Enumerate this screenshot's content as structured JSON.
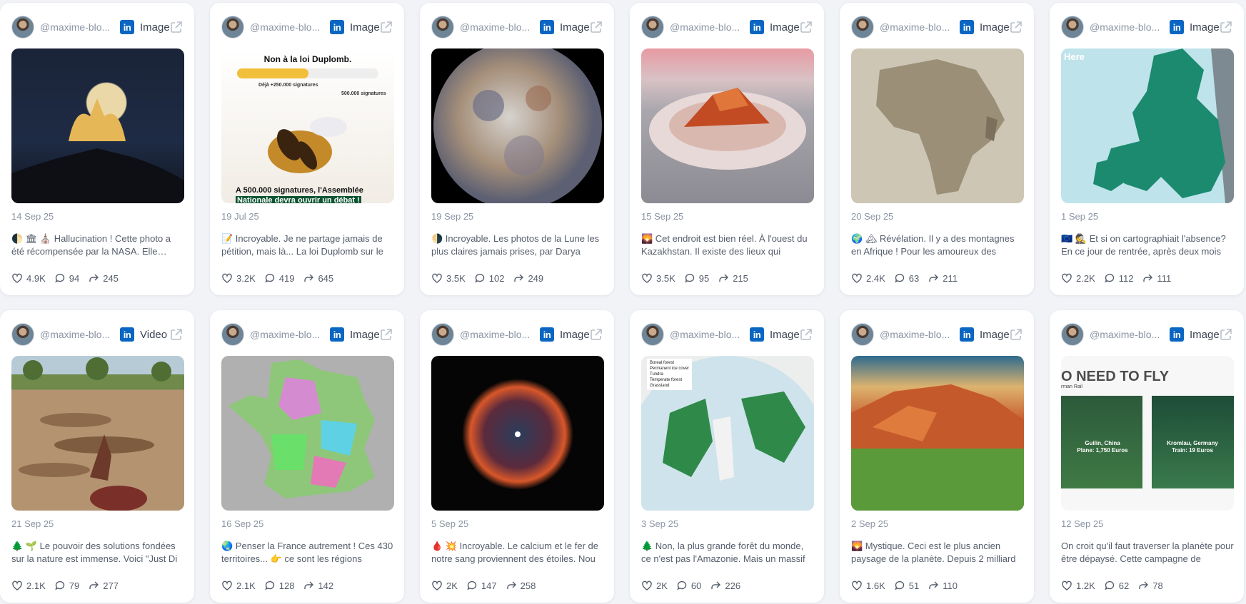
{
  "cards": [
    {
      "handle": "@maxime-blo...",
      "type": "Image",
      "date": "14 Sep 25",
      "text": "🌓 🏛 ⛪ Hallucination ! Cette photo a été récompensée par la NASA. Elle réussit",
      "likes": "4.9K",
      "comments": "94",
      "shares": "245",
      "thumb": "moon-night"
    },
    {
      "handle": "@maxime-blo...",
      "type": "Image",
      "date": "19 Jul 25",
      "text": "📝 Incroyable. Je ne partage jamais de pétition, mais là... La loi Duplomb sur le",
      "likes": "3.2K",
      "comments": "419",
      "shares": "645",
      "thumb": "bee",
      "thumb_text": {
        "title": "Non à la loi Duplomb.",
        "sub1": "Déjà +250.000 signatures",
        "sub2": "500.000 signatures",
        "line1": "A 500.000 signatures, l'Assemblée",
        "line2": "Nationale devra ouvrir un débat !"
      }
    },
    {
      "handle": "@maxime-blo...",
      "type": "Image",
      "date": "19 Sep 25",
      "text": "🌗 Incroyable. Les photos de la Lune les plus claires jamais prises, par Darya",
      "likes": "3.5K",
      "comments": "102",
      "shares": "249",
      "thumb": "lunar"
    },
    {
      "handle": "@maxime-blo...",
      "type": "Image",
      "date": "15 Sep 25",
      "text": "🌄 Cet endroit est bien réel. À l'ouest du Kazakhstan. Il existe des lieux qui",
      "likes": "3.5K",
      "comments": "95",
      "shares": "215",
      "thumb": "kazakh"
    },
    {
      "handle": "@maxime-blo...",
      "type": "Image",
      "date": "20 Sep 25",
      "text": "🌍 🏔 Révélation. Il y a des montagnes en Afrique ! Pour les amoureux des",
      "likes": "2.4K",
      "comments": "63",
      "shares": "211",
      "thumb": "africa"
    },
    {
      "handle": "@maxime-blo...",
      "type": "Image",
      "date": "1 Sep 25",
      "text": "🇪🇺 🕵 Et si on cartographiait l'absence? En ce jour de rentrée, après deux mois",
      "likes": "2.2K",
      "comments": "112",
      "shares": "111",
      "thumb": "europe",
      "thumb_text": {
        "here": "Here"
      }
    },
    {
      "handle": "@maxime-blo...",
      "type": "Video",
      "date": "21 Sep 25",
      "text": "🌲 🌱 Le pouvoir des solutions fondées sur la nature est immense. Voici \"Just Di",
      "likes": "2.1K",
      "comments": "79",
      "shares": "277",
      "thumb": "savanna"
    },
    {
      "handle": "@maxime-blo...",
      "type": "Image",
      "date": "16 Sep 25",
      "text": "🌏 Penser la France autrement ! Ces 430 territoires... 👉 ce sont les régions",
      "likes": "2.1K",
      "comments": "128",
      "shares": "142",
      "thumb": "france"
    },
    {
      "handle": "@maxime-blo...",
      "type": "Image",
      "date": "5 Sep 25",
      "text": "🩸 💥 Incroyable. Le calcium et le fer de notre sang proviennent des étoiles. Nou",
      "likes": "2K",
      "comments": "147",
      "shares": "258",
      "thumb": "nebula"
    },
    {
      "handle": "@maxime-blo...",
      "type": "Image",
      "date": "3 Sep 25",
      "text": "🌲 Non, la plus grande forêt du monde, ce n'est pas l'Amazonie. Mais un massif",
      "likes": "2K",
      "comments": "60",
      "shares": "226",
      "thumb": "globe",
      "thumb_text": {
        "legend": [
          "Boreal forest",
          "Permanent ice cover",
          "Tundra",
          "Temperate forest",
          "Grassland"
        ]
      }
    },
    {
      "handle": "@maxime-blo...",
      "type": "Image",
      "date": "2 Sep 25",
      "text": "🌄 Mystique. Ceci est le plus ancien paysage de la planète. Depuis 2 milliard",
      "likes": "1.6K",
      "comments": "51",
      "shares": "110",
      "thumb": "canyon"
    },
    {
      "handle": "@maxime-blo...",
      "type": "Image",
      "date": "12 Sep 25",
      "text": "On croit qu'il faut traverser la planète pour être dépaysé. Cette campagne de",
      "likes": "1.2K",
      "comments": "62",
      "shares": "78",
      "thumb": "fly",
      "thumb_text": {
        "headline": "O NEED TO FLY",
        "sub": "rman Rail",
        "left": "Guilin, China",
        "left2": "Plane: 1,750 Euros",
        "right": "Kromlau, Germany",
        "right2": "Train: 19 Euros"
      }
    }
  ],
  "icons": {
    "linkedin": "in"
  },
  "colors": {
    "linkedin": "#0a66c2",
    "background": "#f1f3f7",
    "card": "#ffffff"
  }
}
